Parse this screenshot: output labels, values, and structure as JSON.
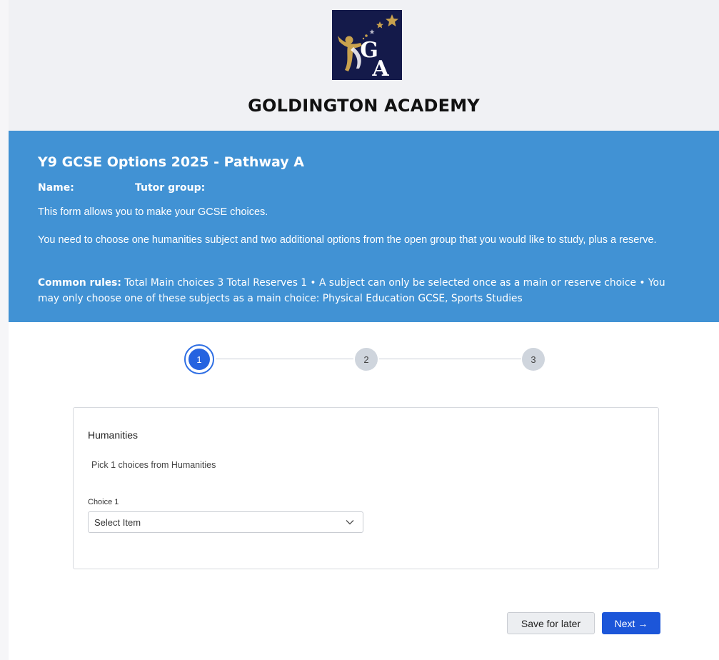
{
  "header": {
    "school_name": "GOLDINGTON ACADEMY",
    "logo_icon": "goldington-academy-crest",
    "logo_text": "GA",
    "colors": {
      "background": "#f0f1f4",
      "logo_bg": "#141a4a",
      "logo_gold": "#c9a24e"
    }
  },
  "banner": {
    "title": "Y9 GCSE Options 2025 - Pathway A",
    "name_label": "Name:",
    "tutor_label": "Tutor group:",
    "intro": "This form allows you to make your GCSE choices.",
    "instructions": "You need to choose one humanities subject and two additional options from the open group that you would like to study, plus a reserve.",
    "rules_label": "Common rules:",
    "rules_text": " Total Main choices 3 Total Reserves 1 • A subject can only be selected once as a main or reserve choice • You may only choose one of these subjects as a main choice: Physical Education GCSE, Sports Studies",
    "color": "#4192d4"
  },
  "stepper": {
    "steps": [
      "1",
      "2",
      "3"
    ],
    "active_step": 1,
    "active_color": "#2563e0"
  },
  "section": {
    "heading": "Humanities",
    "hint": "Pick 1 choices from Humanities",
    "choice_label": "Choice 1",
    "select_value": "Select Item",
    "select_icon": "chevron-down-icon"
  },
  "actions": {
    "save_label": "Save for later",
    "next_label": "Next →",
    "primary_color": "#1c56d9"
  }
}
